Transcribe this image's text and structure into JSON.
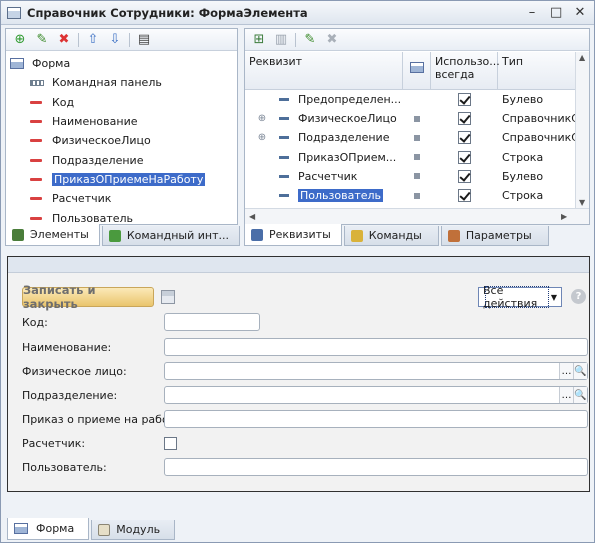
{
  "window": {
    "title": "Справочник Сотрудники: ФормаЭлемента"
  },
  "left_panel": {
    "tree": {
      "root": "Форма",
      "items": [
        {
          "label": "Командная панель",
          "kind": "command-panel"
        },
        {
          "label": "Код",
          "kind": "field"
        },
        {
          "label": "Наименование",
          "kind": "field"
        },
        {
          "label": "ФизическоеЛицо",
          "kind": "field"
        },
        {
          "label": "Подразделение",
          "kind": "field"
        },
        {
          "label": "ПриказОПриемеНаРаботу",
          "kind": "field",
          "selected": true
        },
        {
          "label": "Расчетчик",
          "kind": "field"
        },
        {
          "label": "Пользователь",
          "kind": "field"
        }
      ]
    },
    "tabs": [
      {
        "label": "Элементы",
        "active": true,
        "color": "#4a7d3a"
      },
      {
        "label": "Командный инт...",
        "active": false,
        "color": "#4a9a3e"
      }
    ]
  },
  "right_panel": {
    "columns": {
      "name": "Реквизит",
      "always": "Использо... всегда",
      "type": "Тип"
    },
    "rows": [
      {
        "name": "Предопределен...",
        "expand": false,
        "checked": true,
        "type": "Булево",
        "selected": false
      },
      {
        "name": "ФизическоеЛицо",
        "expand": true,
        "checked": true,
        "type": "СправочникСсь",
        "selected": false
      },
      {
        "name": "Подразделение",
        "expand": true,
        "checked": true,
        "type": "СправочникСсь",
        "selected": false
      },
      {
        "name": "ПриказОПрием...",
        "expand": false,
        "checked": true,
        "type": "Строка",
        "selected": false
      },
      {
        "name": "Расчетчик",
        "expand": false,
        "checked": true,
        "type": "Булево",
        "selected": false
      },
      {
        "name": "Пользователь",
        "expand": false,
        "checked": true,
        "type": "Строка",
        "selected": true
      }
    ],
    "tabs": [
      {
        "label": "Реквизиты",
        "active": true,
        "color": "#4a6ea8"
      },
      {
        "label": "Команды",
        "active": false,
        "color": "#d9b23a"
      },
      {
        "label": "Параметры",
        "active": false,
        "color": "#c0703a"
      }
    ]
  },
  "preview": {
    "save_close": "Записать и закрыть",
    "all_actions": "Все действия",
    "help": "?",
    "fields": [
      {
        "label": "Код:",
        "kind": "short"
      },
      {
        "label": "Наименование:",
        "kind": "text"
      },
      {
        "label": "Физическое лицо:",
        "kind": "ref"
      },
      {
        "label": "Подразделение:",
        "kind": "ref"
      },
      {
        "label": "Приказ о приеме на работу:",
        "kind": "text"
      },
      {
        "label": "Расчетчик:",
        "kind": "check"
      },
      {
        "label": "Пользователь:",
        "kind": "text"
      }
    ]
  },
  "bottom_tabs": [
    {
      "label": "Форма",
      "active": true
    },
    {
      "label": "Модуль",
      "active": false
    }
  ]
}
